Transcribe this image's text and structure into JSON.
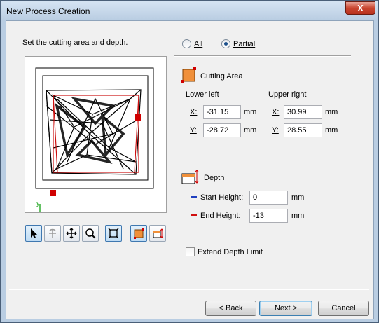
{
  "window": {
    "title": "New Process Creation",
    "close_label": "X"
  },
  "instruction": "Set the cutting area and depth.",
  "mode": {
    "all_label": "All",
    "partial_label": "Partial",
    "selected": "Partial"
  },
  "cutting_area": {
    "title": "Cutting Area",
    "lower_left_label": "Lower left",
    "upper_right_label": "Upper right",
    "x_label": "X:",
    "y_label": "Y:",
    "unit": "mm",
    "lower_left": {
      "x": "-31.15",
      "y": "-28.72"
    },
    "upper_right": {
      "x": "30.99",
      "y": "28.55"
    }
  },
  "depth": {
    "title": "Depth",
    "start_height_label": "Start Height:",
    "start_height": "0",
    "end_height_label": "End Height:",
    "end_height": "-13",
    "unit": "mm",
    "start_color": "#1f3fbf",
    "end_color": "#d01010"
  },
  "extend_depth_limit": {
    "label": "Extend Depth Limit",
    "checked": false
  },
  "toolbar": {
    "tools": [
      "select-arrow-icon",
      "rotate-icon",
      "pan-icon",
      "zoom-icon",
      "fit-view-icon",
      "cutting-area-icon",
      "depth-icon"
    ]
  },
  "buttons": {
    "back": "< Back",
    "next": "Next >",
    "cancel": "Cancel"
  }
}
